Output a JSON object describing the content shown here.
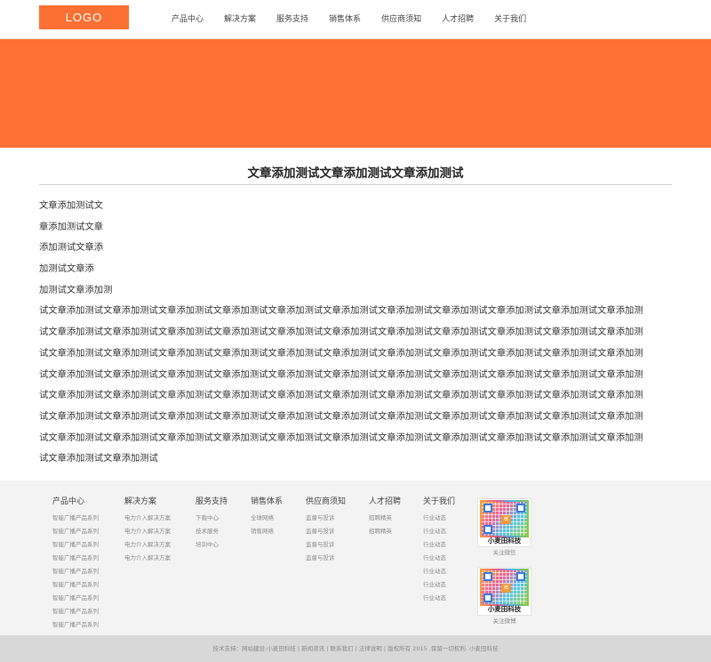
{
  "header": {
    "logo": "LOGO",
    "nav": [
      "产品中心",
      "解决方案",
      "服务支持",
      "销售体系",
      "供应商须知",
      "人才招聘",
      "关于我们"
    ]
  },
  "colors": {
    "accent": "#fd7033",
    "banner": "#fe7033",
    "footer_bg": "#f3f3f3",
    "copyright_bg": "#d8d8d8"
  },
  "article": {
    "title": "文章添加测试文章添加测试文章添加测试",
    "lines": [
      "文章添加测试文",
      "章添加测试文章",
      "添加测试文章添",
      "加测试文章添",
      "加测试文章添加测",
      "试文章添加测试文章添加测试文章添加测试文章添加测试文章添加测试文章添加测试文章添加测试文章添加测试文章添加测试文章添加测试文章添加测",
      "试文章添加测试文章添加测试文章添加测试文章添加测试文章添加测试文章添加测试文章添加测试文章添加测试文章添加测试文章添加测试文章添加测",
      "试文章添加测试文章添加测试文章添加测试文章添加测试文章添加测试文章添加测试文章添加测试文章添加测试文章添加测试文章添加测试文章添加测",
      "试文章添加测试文章添加测试文章添加测试文章添加测试文章添加测试文章添加测试文章添加测试文章添加测试文章添加测试文章添加测试文章添加测",
      "试文章添加测试文章添加测试文章添加测试文章添加测试文章添加测试文章添加测试文章添加测试文章添加测试文章添加测试文章添加测试文章添加测",
      "试文章添加测试文章添加测试文章添加测试文章添加测试文章添加测试文章添加测试文章添加测试文章添加测试文章添加测试文章添加测试文章添加测",
      "试文章添加测试文章添加测试文章添加测试文章添加测试文章添加测试文章添加测试文章添加测试文章添加测试文章添加测试文章添加测试文章添加测",
      "试文章添加测试文章添加测试"
    ]
  },
  "footer": {
    "columns": [
      {
        "title": "产品中心",
        "links": [
          "智能广播产品系列",
          "智能广播产品系列",
          "智能广播产品系列",
          "智能广播产品系列",
          "智能广播产品系列",
          "智能广播产品系列",
          "智能广播产品系列",
          "智能广播产品系列",
          "智能广播产品系列"
        ]
      },
      {
        "title": "解决方案",
        "links": [
          "电力介入解决方案",
          "电力介入解决方案",
          "电力介入解决方案",
          "电力介入解决方案"
        ]
      },
      {
        "title": "服务支持",
        "links": [
          "下载中心",
          "技术服务",
          "培训中心"
        ]
      },
      {
        "title": "销售体系",
        "links": [
          "全球网络",
          "销售网络"
        ]
      },
      {
        "title": "供应商须知",
        "links": [
          "监督与投诉",
          "监督与投诉",
          "监督与投诉",
          "监督与投诉"
        ]
      },
      {
        "title": "人才招聘",
        "links": [
          "招聘精英",
          "招聘精英"
        ]
      },
      {
        "title": "关于我们",
        "links": [
          "行业动态",
          "行业动态",
          "行业动态",
          "行业动态",
          "行业动态",
          "行业动态",
          "行业动态"
        ]
      }
    ],
    "qr_codes": [
      {
        "name": "小麦田科技",
        "caption": "关注微信",
        "badge": "微"
      },
      {
        "name": "小麦田科技",
        "caption": "关注微博",
        "badge": "微"
      }
    ],
    "copyright": "技术支持：网站建设-小麦田科技 | 新闻资讯 | 联系我们 | 法律说明 | 版权所有 2015 ,保留一切权利. 小麦田科技"
  }
}
